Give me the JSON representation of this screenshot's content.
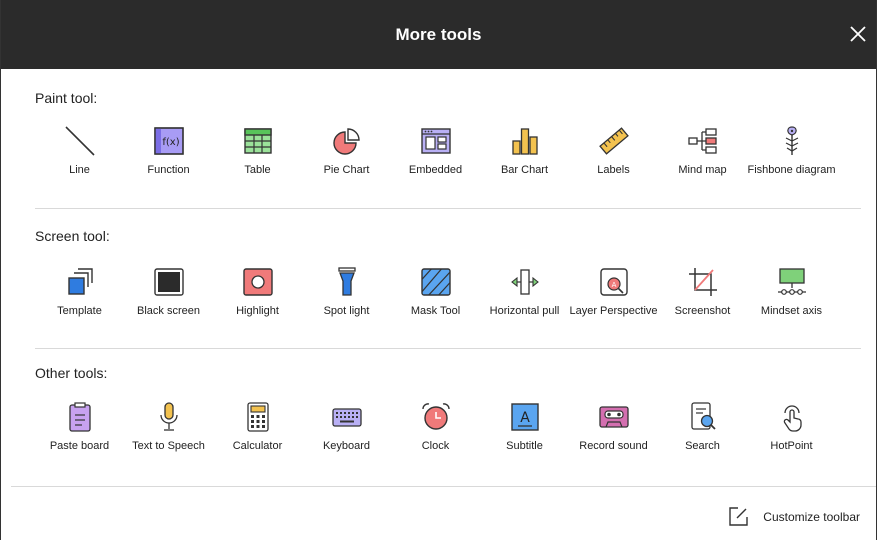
{
  "header": {
    "title": "More tools"
  },
  "sections": {
    "paint": {
      "label": "Paint tool:",
      "items": [
        "Line",
        "Function",
        "Table",
        "Pie Chart",
        "Embedded",
        "Bar Chart",
        "Labels",
        "Mind  map",
        "Fishbone diagram"
      ]
    },
    "screen": {
      "label": "Screen tool:",
      "items": [
        "Template",
        "Black screen",
        "Highlight",
        "Spot light",
        "Mask Tool",
        "Horizontal pull",
        "Layer Perspective",
        "Screenshot",
        "Mindset axis"
      ]
    },
    "other": {
      "label": "Other tools:",
      "items": [
        "Paste board",
        "Text to Speech",
        "Calculator",
        "Keyboard",
        "Clock",
        "Subtitle",
        "Record sound",
        "Search",
        "HotPoint"
      ]
    }
  },
  "icons": {
    "paint": [
      "line-icon",
      "function-icon",
      "table-icon",
      "pie-chart-icon",
      "embedded-icon",
      "bar-chart-icon",
      "ruler-icon",
      "mind-map-icon",
      "fishbone-icon"
    ],
    "screen": [
      "template-icon",
      "black-screen-icon",
      "highlight-icon",
      "spotlight-icon",
      "mask-icon",
      "horizontal-pull-icon",
      "layer-perspective-icon",
      "screenshot-icon",
      "mindset-axis-icon"
    ],
    "other": [
      "clipboard-icon",
      "microphone-icon",
      "calculator-icon",
      "keyboard-icon",
      "alarm-clock-icon",
      "subtitle-icon",
      "cassette-icon",
      "search-document-icon",
      "touch-icon"
    ]
  },
  "footer": {
    "customize_label": "Customize toolbar"
  },
  "colors": {
    "header_bg": "#2b2b2b",
    "accent_blue": "#2f7ce0",
    "accent_red": "#f06b6b",
    "accent_green": "#7fd17a",
    "accent_purple": "#9a8ff0",
    "accent_yellow": "#f3c24f"
  }
}
